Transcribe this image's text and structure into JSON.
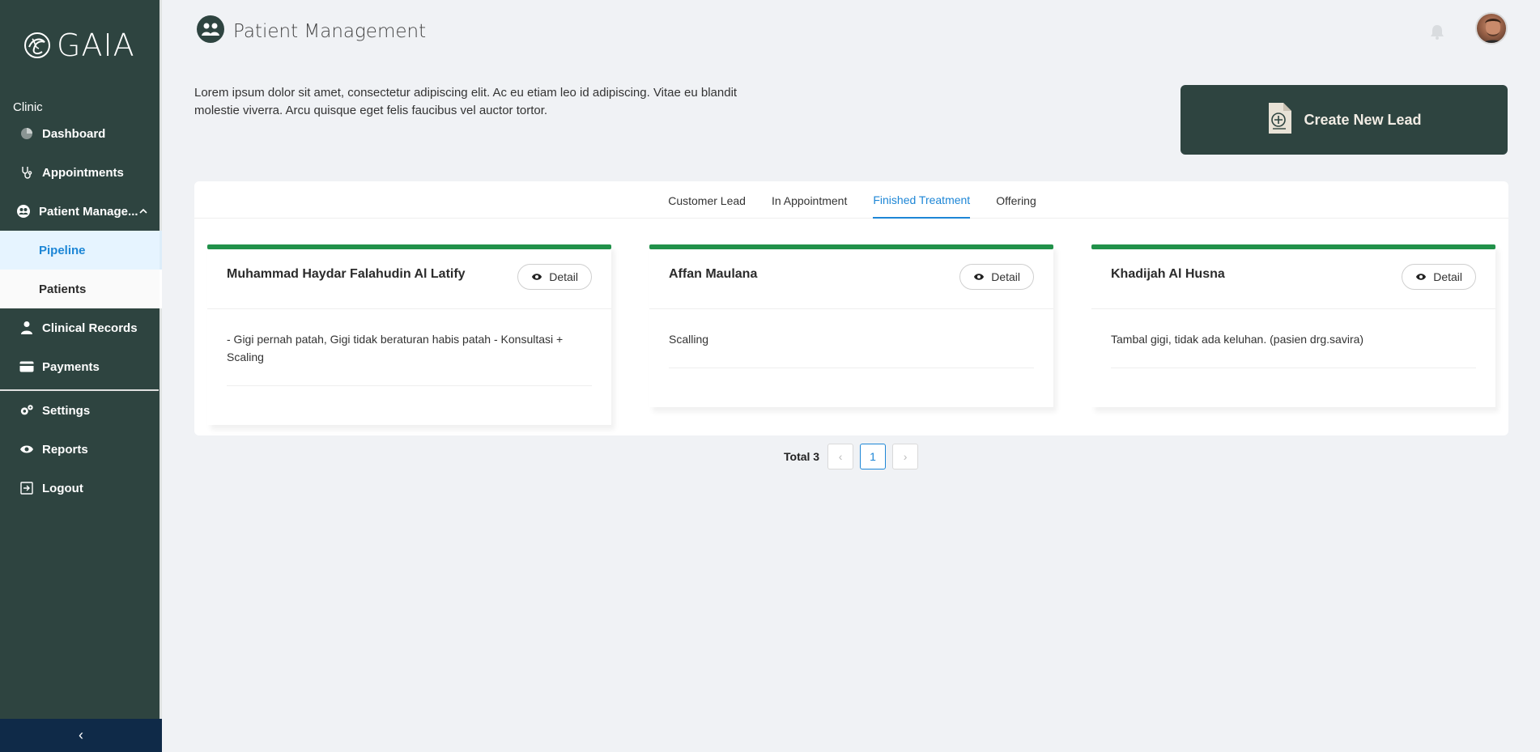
{
  "app": {
    "logo_text": "GAIA"
  },
  "sidebar": {
    "section_label": "Clinic",
    "items": [
      {
        "label": "Dashboard",
        "icon": "pie-chart-icon"
      },
      {
        "label": "Appointments",
        "icon": "stethoscope-icon"
      },
      {
        "label": "Patient Manage...",
        "icon": "patients-icon",
        "expanded": true
      },
      {
        "label": "Clinical Records",
        "icon": "doctor-icon"
      },
      {
        "label": "Payments",
        "icon": "credit-card-icon"
      },
      {
        "label": "Settings",
        "icon": "gear-icon"
      },
      {
        "label": "Reports",
        "icon": "eye-icon"
      },
      {
        "label": "Logout",
        "icon": "logout-icon"
      }
    ],
    "sub_items": [
      {
        "label": "Pipeline",
        "active": true
      },
      {
        "label": "Patients",
        "active": false
      }
    ],
    "collapse_glyph": "‹"
  },
  "header": {
    "title": "Patient Management",
    "description": "Lorem ipsum dolor sit amet, consectetur adipiscing elit. Ac eu etiam leo id adipiscing. Vitae eu blandit molestie viverra. Arcu quisque eget felis faucibus vel auctor tortor."
  },
  "create_button": {
    "label": "Create New Lead"
  },
  "tabs": [
    {
      "label": "Customer Lead",
      "active": false
    },
    {
      "label": "In Appointment",
      "active": false
    },
    {
      "label": "Finished Treatment",
      "active": true
    },
    {
      "label": "Offering",
      "active": false
    }
  ],
  "cards": [
    {
      "name": "Muhammad Haydar Falahudin Al Latify",
      "detail_label": "Detail",
      "note": "- Gigi pernah patah, Gigi tidak beraturan habis patah - Konsultasi + Scaling"
    },
    {
      "name": "Affan Maulana",
      "detail_label": "Detail",
      "note": "Scalling"
    },
    {
      "name": "Khadijah Al Husna",
      "detail_label": "Detail",
      "note": "Tambal gigi, tidak ada keluhan. (pasien drg.savira)"
    }
  ],
  "pagination": {
    "total_label": "Total 3",
    "current_page": "1",
    "prev_glyph": "‹",
    "next_glyph": "›"
  },
  "colors": {
    "sidebar": "#2e4440",
    "accent": "#1d86d6",
    "card_top": "#21914a",
    "collapse_bar": "#0f2a48"
  }
}
